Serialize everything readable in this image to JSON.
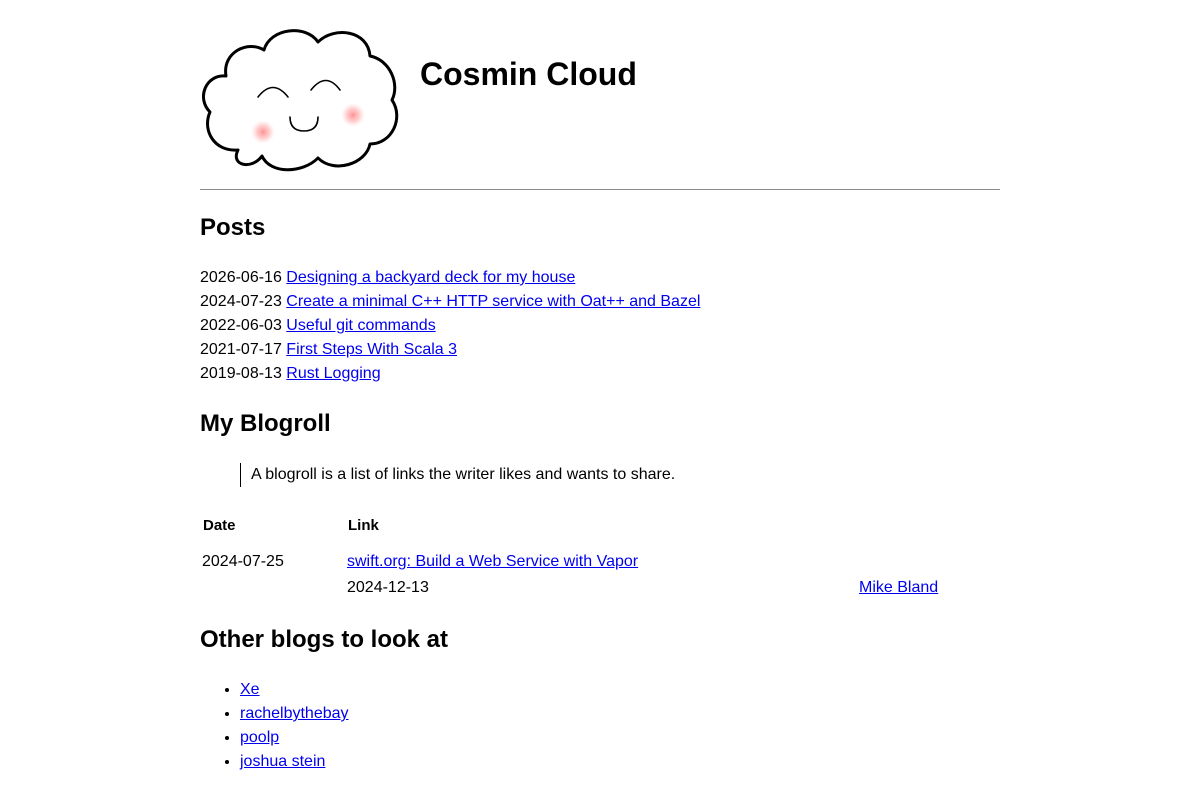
{
  "site": {
    "title": "Cosmin Cloud",
    "logo_icon": "smiling-cloud-icon"
  },
  "posts": {
    "heading": "Posts",
    "items": [
      {
        "date": "2026-06-16",
        "title": "Designing a backyard deck for my house"
      },
      {
        "date": "2024-07-23",
        "title": "Create a minimal C++ HTTP service with Oat++ and Bazel"
      },
      {
        "date": "2022-06-03",
        "title": "Useful git commands"
      },
      {
        "date": "2021-07-17",
        "title": "First Steps With Scala 3"
      },
      {
        "date": "2019-08-13",
        "title": "Rust Logging"
      }
    ]
  },
  "blogroll": {
    "heading": "My Blogroll",
    "description": "A blogroll is a list of links the writer likes and wants to share.",
    "columns": [
      "Date",
      "Link"
    ],
    "rows": [
      {
        "date": "2024-07-25",
        "link": "swift.org: Build a Web Service with Vapor",
        "sub_date": "2024-12-13",
        "author": "Mike Bland"
      }
    ]
  },
  "other_blogs": {
    "heading": "Other blogs to look at",
    "items": [
      "Xe",
      "rachelbythebay",
      "poolp",
      "joshua stein"
    ]
  },
  "colors": {
    "link": "#0000ee",
    "text": "#000000",
    "divider": "#8c8c8c",
    "cheek": "#ff9a9a"
  }
}
